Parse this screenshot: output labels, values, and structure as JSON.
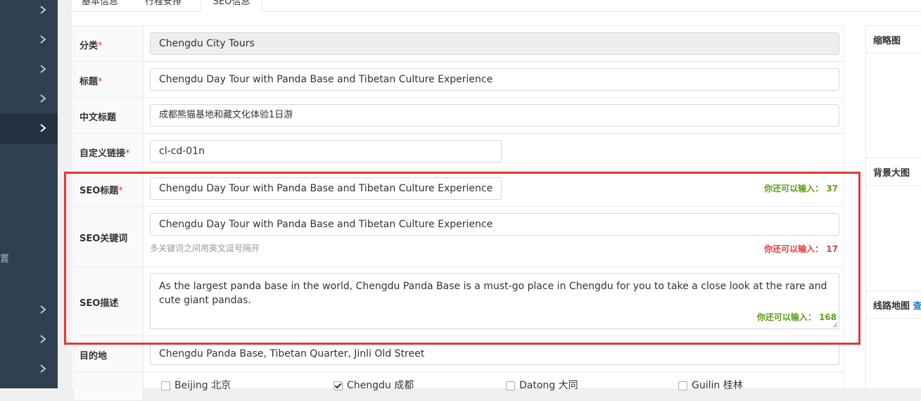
{
  "sidebar": {
    "item_count": 11,
    "active_index": 4,
    "cut_text": "置"
  },
  "tabs": [
    {
      "label": "基本信息"
    },
    {
      "label": "行程安排"
    },
    {
      "label": "SEO信息"
    }
  ],
  "form": {
    "category": {
      "label": "分类",
      "required": "*",
      "value": "Chengdu City Tours"
    },
    "title": {
      "label": "标题",
      "required": "*",
      "value": "Chengdu Day Tour with Panda Base and Tibetan Culture Experience"
    },
    "cn_title": {
      "label": "中文标题",
      "value": "成都熊猫基地和藏文化体验1日游"
    },
    "custom_link": {
      "label": "自定义链接",
      "required": "*",
      "value": "cl-cd-01n"
    },
    "seo_title": {
      "label": "SEO标题",
      "required": "*",
      "value": "Chengdu Day Tour with Panda Base and Tibetan Culture Experience",
      "counter": "你还可以输入： 37"
    },
    "seo_keywords": {
      "label": "SEO关键词",
      "value": "Chengdu Day Tour with Panda Base and Tibetan Culture Experience",
      "hint": "多关键词之间用英文逗号隔开",
      "counter": "你还可以输入： 17"
    },
    "seo_desc": {
      "label": "SEO描述",
      "value": "As the largest panda base in the world, Chengdu Panda Base is a must-go place in Chengdu for you to take a close look at the rare and cute giant pandas.",
      "counter": "你还可以输入： 168"
    },
    "destination": {
      "label": "目的地",
      "value": "Chengdu Panda Base, Tibetan Quarter, Jinli Old Street"
    },
    "cities": [
      {
        "label": "Beijing 北京",
        "checked": false
      },
      {
        "label": "Chengdu 成都",
        "checked": true
      },
      {
        "label": "Datong 大同",
        "checked": false
      },
      {
        "label": "Guilin 桂林",
        "checked": false
      }
    ]
  },
  "right": {
    "thumbnail": "缩略图",
    "background": "背景大图",
    "route_map": "线路地图",
    "route_map_link": "查"
  },
  "colors": {
    "sidebar_bg": "#2f4050",
    "highlight": "#e53935",
    "counter_green": "#5a9e1a",
    "counter_red": "#e4393c"
  }
}
